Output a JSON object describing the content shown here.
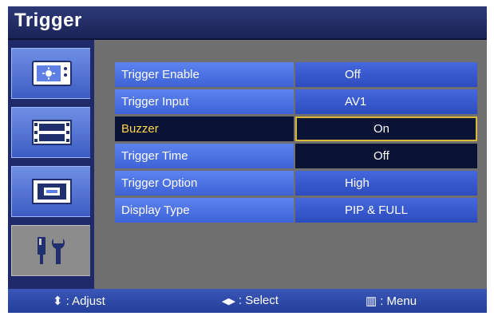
{
  "title": "Trigger",
  "sidebar": {
    "tabs": [
      {
        "name": "picture"
      },
      {
        "name": "video"
      },
      {
        "name": "pip"
      },
      {
        "name": "setup"
      }
    ]
  },
  "menu": {
    "rows": [
      {
        "label": "Trigger Enable",
        "value": "Off"
      },
      {
        "label": "Trigger Input",
        "value": "AV1"
      },
      {
        "label": "Buzzer",
        "value": "On"
      },
      {
        "label": "Trigger Time",
        "value": "Off"
      },
      {
        "label": "Trigger Option",
        "value": "High"
      },
      {
        "label": "Display Type",
        "value": "PIP & FULL"
      }
    ]
  },
  "footer": {
    "adjust_glyph": "⬍",
    "adjust_label": ": Adjust",
    "select_glyph": "◀▶",
    "select_label": ": Select",
    "menu_glyph": "▥",
    "menu_label": ": Menu"
  },
  "colors": {
    "title_bg": "#1a2356",
    "row_bg": "#3d62d6",
    "selected_bg": "#0a1235",
    "highlight_text": "#ffd64a",
    "body_bg": "#6f6f6f"
  }
}
